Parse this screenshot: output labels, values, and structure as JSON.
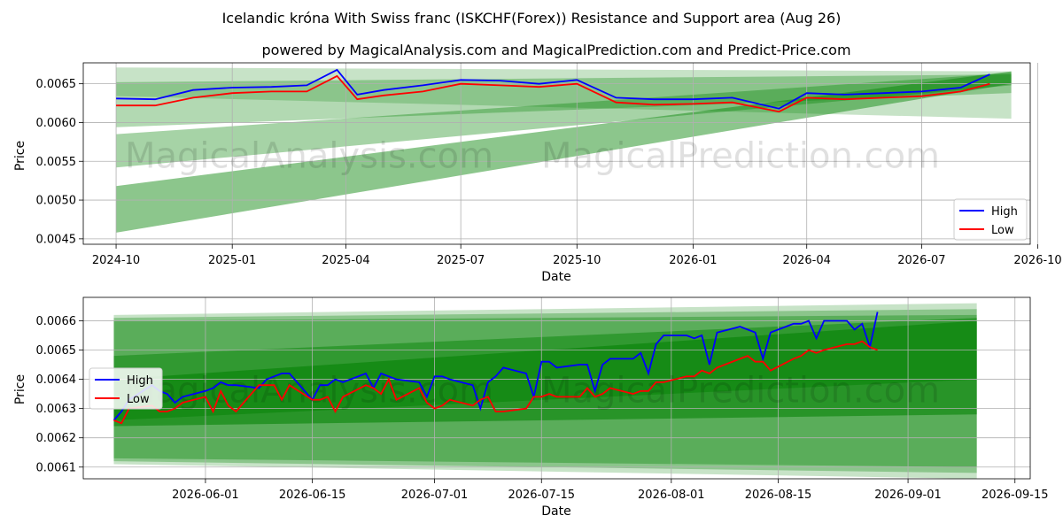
{
  "title": "Icelandic króna With Swiss franc (ISKCHF(Forex)) Resistance and Support area (Aug 26)",
  "subtitle": "powered by MagicalAnalysis.com and MagicalPrediction.com and Predict-Price.com",
  "watermarks": [
    "MagicalAnalysis.com",
    "MagicalPrediction.com"
  ],
  "colors": {
    "high": "#0000ff",
    "low": "#ff0000",
    "band": "#008000",
    "grid": "#b0b0b0"
  },
  "chart_data": [
    {
      "type": "line",
      "xlabel": "Date",
      "ylabel": "Price",
      "xlim": [
        "2024-09-05",
        "2026-09-25"
      ],
      "ylim": [
        0.00443,
        0.00677
      ],
      "grid": true,
      "legend_position": "lower-right",
      "x_ticks": [
        "2024-10",
        "2025-01",
        "2025-04",
        "2025-07",
        "2025-10",
        "2026-01",
        "2026-04",
        "2026-07",
        "2026-10"
      ],
      "y_ticks": [
        "0.0045",
        "0.0050",
        "0.0055",
        "0.0060",
        "0.0065"
      ],
      "bands": [
        {
          "x": [
            "2024-10-01",
            "2026-09-10"
          ],
          "upper": [
            0.00671,
            0.00666
          ],
          "lower": [
            0.00634,
            0.00605
          ]
        },
        {
          "x": [
            "2024-10-01",
            "2026-09-10"
          ],
          "upper": [
            0.00652,
            0.00662
          ],
          "lower": [
            0.00594,
            0.00638
          ]
        },
        {
          "x": [
            "2024-10-01",
            "2026-09-10"
          ],
          "upper": [
            0.00585,
            0.00664
          ],
          "lower": [
            0.00542,
            0.00648
          ]
        },
        {
          "x": [
            "2024-10-01",
            "2026-09-10"
          ],
          "upper": [
            0.00518,
            0.00666
          ],
          "lower": [
            0.00458,
            0.0065
          ]
        }
      ],
      "series": [
        {
          "name": "High",
          "points": [
            [
              "2024-10-01",
              0.00631
            ],
            [
              "2024-11-01",
              0.0063
            ],
            [
              "2024-12-01",
              0.00642
            ],
            [
              "2025-01-01",
              0.00645
            ],
            [
              "2025-02-01",
              0.00646
            ],
            [
              "2025-03-01",
              0.00648
            ],
            [
              "2025-03-25",
              0.00668
            ],
            [
              "2025-04-10",
              0.00636
            ],
            [
              "2025-05-01",
              0.00642
            ],
            [
              "2025-06-01",
              0.00648
            ],
            [
              "2025-07-01",
              0.00655
            ],
            [
              "2025-08-01",
              0.00654
            ],
            [
              "2025-09-01",
              0.0065
            ],
            [
              "2025-10-01",
              0.00655
            ],
            [
              "2025-11-01",
              0.00632
            ],
            [
              "2025-12-01",
              0.0063
            ],
            [
              "2026-01-01",
              0.0063
            ],
            [
              "2026-02-01",
              0.00632
            ],
            [
              "2026-03-10",
              0.00618
            ],
            [
              "2026-04-01",
              0.00638
            ],
            [
              "2026-05-01",
              0.00636
            ],
            [
              "2026-06-01",
              0.00638
            ],
            [
              "2026-07-01",
              0.0064
            ],
            [
              "2026-08-01",
              0.00645
            ],
            [
              "2026-08-24",
              0.00662
            ]
          ]
        },
        {
          "name": "Low",
          "points": [
            [
              "2024-10-01",
              0.00622
            ],
            [
              "2024-11-01",
              0.00622
            ],
            [
              "2024-12-01",
              0.00632
            ],
            [
              "2025-01-01",
              0.00638
            ],
            [
              "2025-02-01",
              0.0064
            ],
            [
              "2025-03-01",
              0.0064
            ],
            [
              "2025-03-25",
              0.0066
            ],
            [
              "2025-04-10",
              0.0063
            ],
            [
              "2025-05-01",
              0.00635
            ],
            [
              "2025-06-01",
              0.0064
            ],
            [
              "2025-07-01",
              0.0065
            ],
            [
              "2025-08-01",
              0.00648
            ],
            [
              "2025-09-01",
              0.00646
            ],
            [
              "2025-10-01",
              0.0065
            ],
            [
              "2025-11-01",
              0.00626
            ],
            [
              "2025-12-01",
              0.00623
            ],
            [
              "2026-01-01",
              0.00624
            ],
            [
              "2026-02-01",
              0.00626
            ],
            [
              "2026-03-10",
              0.00614
            ],
            [
              "2026-04-01",
              0.00632
            ],
            [
              "2026-05-01",
              0.0063
            ],
            [
              "2026-06-01",
              0.00632
            ],
            [
              "2026-07-01",
              0.00634
            ],
            [
              "2026-08-01",
              0.0064
            ],
            [
              "2026-08-24",
              0.0065
            ]
          ]
        }
      ]
    },
    {
      "type": "line",
      "xlabel": "Date",
      "ylabel": "Price",
      "xlim": [
        "2026-05-16",
        "2026-09-17"
      ],
      "ylim": [
        0.00606,
        0.00668
      ],
      "grid": true,
      "legend_position": "center-left",
      "x_ticks": [
        "2026-06-01",
        "2026-06-15",
        "2026-07-01",
        "2026-07-15",
        "2026-08-01",
        "2026-08-15",
        "2026-09-01",
        "2026-09-15"
      ],
      "y_ticks": [
        "0.0061",
        "0.0062",
        "0.0063",
        "0.0064",
        "0.0065",
        "0.0066"
      ],
      "bands": [
        {
          "x": [
            "2026-05-20",
            "2026-09-10"
          ],
          "upper": [
            0.00662,
            0.00666
          ],
          "lower": [
            0.00611,
            0.00606
          ]
        },
        {
          "x": [
            "2026-05-20",
            "2026-09-10"
          ],
          "upper": [
            0.00661,
            0.00664
          ],
          "lower": [
            0.00612,
            0.00608
          ]
        },
        {
          "x": [
            "2026-05-20",
            "2026-09-10"
          ],
          "upper": [
            0.0066,
            0.00662
          ],
          "lower": [
            0.00613,
            0.0061
          ]
        },
        {
          "x": [
            "2026-05-20",
            "2026-09-10"
          ],
          "upper": [
            0.00648,
            0.00661
          ],
          "lower": [
            0.00626,
            0.0064
          ]
        },
        {
          "x": [
            "2026-05-20",
            "2026-09-10"
          ],
          "upper": [
            0.0064,
            0.0066
          ],
          "lower": [
            0.00624,
            0.00628
          ]
        }
      ],
      "series": [
        {
          "name": "High",
          "points": [
            [
              "2026-05-20",
              0.00626
            ],
            [
              "2026-05-21",
              0.00629
            ],
            [
              "2026-05-22",
              0.00633
            ],
            [
              "2026-05-25",
              0.00638
            ],
            [
              "2026-05-26",
              0.00636
            ],
            [
              "2026-05-27",
              0.00635
            ],
            [
              "2026-05-28",
              0.00632
            ],
            [
              "2026-05-29",
              0.00634
            ],
            [
              "2026-06-01",
              0.00636
            ],
            [
              "2026-06-02",
              0.00637
            ],
            [
              "2026-06-03",
              0.00639
            ],
            [
              "2026-06-04",
              0.00638
            ],
            [
              "2026-06-05",
              0.00638
            ],
            [
              "2026-06-08",
              0.00637
            ],
            [
              "2026-06-09",
              0.0064
            ],
            [
              "2026-06-10",
              0.00641
            ],
            [
              "2026-06-11",
              0.00642
            ],
            [
              "2026-06-12",
              0.00642
            ],
            [
              "2026-06-15",
              0.00633
            ],
            [
              "2026-06-16",
              0.00638
            ],
            [
              "2026-06-17",
              0.00638
            ],
            [
              "2026-06-18",
              0.0064
            ],
            [
              "2026-06-19",
              0.00639
            ],
            [
              "2026-06-22",
              0.00642
            ],
            [
              "2026-06-23",
              0.00637
            ],
            [
              "2026-06-24",
              0.00642
            ],
            [
              "2026-06-25",
              0.00641
            ],
            [
              "2026-06-26",
              0.0064
            ],
            [
              "2026-06-29",
              0.00639
            ],
            [
              "2026-06-30",
              0.00634
            ],
            [
              "2026-07-01",
              0.00641
            ],
            [
              "2026-07-02",
              0.00641
            ],
            [
              "2026-07-03",
              0.0064
            ],
            [
              "2026-07-06",
              0.00638
            ],
            [
              "2026-07-07",
              0.0063
            ],
            [
              "2026-07-08",
              0.00639
            ],
            [
              "2026-07-09",
              0.00641
            ],
            [
              "2026-07-10",
              0.00644
            ],
            [
              "2026-07-13",
              0.00642
            ],
            [
              "2026-07-14",
              0.00634
            ],
            [
              "2026-07-15",
              0.00646
            ],
            [
              "2026-07-16",
              0.00646
            ],
            [
              "2026-07-17",
              0.00644
            ],
            [
              "2026-07-20",
              0.00645
            ],
            [
              "2026-07-21",
              0.00645
            ],
            [
              "2026-07-22",
              0.00636
            ],
            [
              "2026-07-23",
              0.00645
            ],
            [
              "2026-07-24",
              0.00647
            ],
            [
              "2026-07-27",
              0.00647
            ],
            [
              "2026-07-28",
              0.00649
            ],
            [
              "2026-07-29",
              0.00642
            ],
            [
              "2026-07-30",
              0.00652
            ],
            [
              "2026-07-31",
              0.00655
            ],
            [
              "2026-08-03",
              0.00655
            ],
            [
              "2026-08-04",
              0.00654
            ],
            [
              "2026-08-05",
              0.00655
            ],
            [
              "2026-08-06",
              0.00645
            ],
            [
              "2026-08-07",
              0.00656
            ],
            [
              "2026-08-10",
              0.00658
            ],
            [
              "2026-08-11",
              0.00657
            ],
            [
              "2026-08-12",
              0.00656
            ],
            [
              "2026-08-13",
              0.00647
            ],
            [
              "2026-08-14",
              0.00656
            ],
            [
              "2026-08-17",
              0.00659
            ],
            [
              "2026-08-18",
              0.00659
            ],
            [
              "2026-08-19",
              0.0066
            ],
            [
              "2026-08-20",
              0.00654
            ],
            [
              "2026-08-21",
              0.0066
            ],
            [
              "2026-08-24",
              0.0066
            ],
            [
              "2026-08-25",
              0.00657
            ],
            [
              "2026-08-26",
              0.00659
            ],
            [
              "2026-08-27",
              0.00651
            ],
            [
              "2026-08-28",
              0.00663
            ]
          ]
        },
        {
          "name": "Low",
          "points": [
            [
              "2026-05-20",
              0.00626
            ],
            [
              "2026-05-21",
              0.00625
            ],
            [
              "2026-05-22",
              0.0063
            ],
            [
              "2026-05-25",
              0.00631
            ],
            [
              "2026-05-26",
              0.00629
            ],
            [
              "2026-05-27",
              0.00629
            ],
            [
              "2026-05-28",
              0.0063
            ],
            [
              "2026-05-29",
              0.00632
            ],
            [
              "2026-06-01",
              0.00634
            ],
            [
              "2026-06-02",
              0.00629
            ],
            [
              "2026-06-03",
              0.00636
            ],
            [
              "2026-06-04",
              0.00631
            ],
            [
              "2026-06-05",
              0.00629
            ],
            [
              "2026-06-08",
              0.00638
            ],
            [
              "2026-06-09",
              0.00638
            ],
            [
              "2026-06-10",
              0.00638
            ],
            [
              "2026-06-11",
              0.00633
            ],
            [
              "2026-06-12",
              0.00638
            ],
            [
              "2026-06-15",
              0.00633
            ],
            [
              "2026-06-16",
              0.00633
            ],
            [
              "2026-06-17",
              0.00634
            ],
            [
              "2026-06-18",
              0.00629
            ],
            [
              "2026-06-19",
              0.00634
            ],
            [
              "2026-06-22",
              0.00638
            ],
            [
              "2026-06-23",
              0.00637
            ],
            [
              "2026-06-24",
              0.00635
            ],
            [
              "2026-06-25",
              0.0064
            ],
            [
              "2026-06-26",
              0.00633
            ],
            [
              "2026-06-29",
              0.00637
            ],
            [
              "2026-06-30",
              0.00632
            ],
            [
              "2026-07-01",
              0.0063
            ],
            [
              "2026-07-02",
              0.00631
            ],
            [
              "2026-07-03",
              0.00633
            ],
            [
              "2026-07-06",
              0.00631
            ],
            [
              "2026-07-07",
              0.00633
            ],
            [
              "2026-07-08",
              0.00634
            ],
            [
              "2026-07-09",
              0.00629
            ],
            [
              "2026-07-10",
              0.00629
            ],
            [
              "2026-07-13",
              0.0063
            ],
            [
              "2026-07-14",
              0.00634
            ],
            [
              "2026-07-15",
              0.00634
            ],
            [
              "2026-07-16",
              0.00635
            ],
            [
              "2026-07-17",
              0.00634
            ],
            [
              "2026-07-20",
              0.00634
            ],
            [
              "2026-07-21",
              0.00637
            ],
            [
              "2026-07-22",
              0.00634
            ],
            [
              "2026-07-23",
              0.00635
            ],
            [
              "2026-07-24",
              0.00637
            ],
            [
              "2026-07-27",
              0.00635
            ],
            [
              "2026-07-28",
              0.00636
            ],
            [
              "2026-07-29",
              0.00636
            ],
            [
              "2026-07-30",
              0.00639
            ],
            [
              "2026-07-31",
              0.00639
            ],
            [
              "2026-08-03",
              0.00641
            ],
            [
              "2026-08-04",
              0.00641
            ],
            [
              "2026-08-05",
              0.00643
            ],
            [
              "2026-08-06",
              0.00642
            ],
            [
              "2026-08-07",
              0.00644
            ],
            [
              "2026-08-10",
              0.00647
            ],
            [
              "2026-08-11",
              0.00648
            ],
            [
              "2026-08-12",
              0.00646
            ],
            [
              "2026-08-13",
              0.00646
            ],
            [
              "2026-08-14",
              0.00643
            ],
            [
              "2026-08-17",
              0.00647
            ],
            [
              "2026-08-18",
              0.00648
            ],
            [
              "2026-08-19",
              0.0065
            ],
            [
              "2026-08-20",
              0.00649
            ],
            [
              "2026-08-21",
              0.0065
            ],
            [
              "2026-08-24",
              0.00652
            ],
            [
              "2026-08-25",
              0.00652
            ],
            [
              "2026-08-26",
              0.00653
            ],
            [
              "2026-08-27",
              0.00651
            ],
            [
              "2026-08-28",
              0.0065
            ]
          ]
        }
      ]
    }
  ]
}
